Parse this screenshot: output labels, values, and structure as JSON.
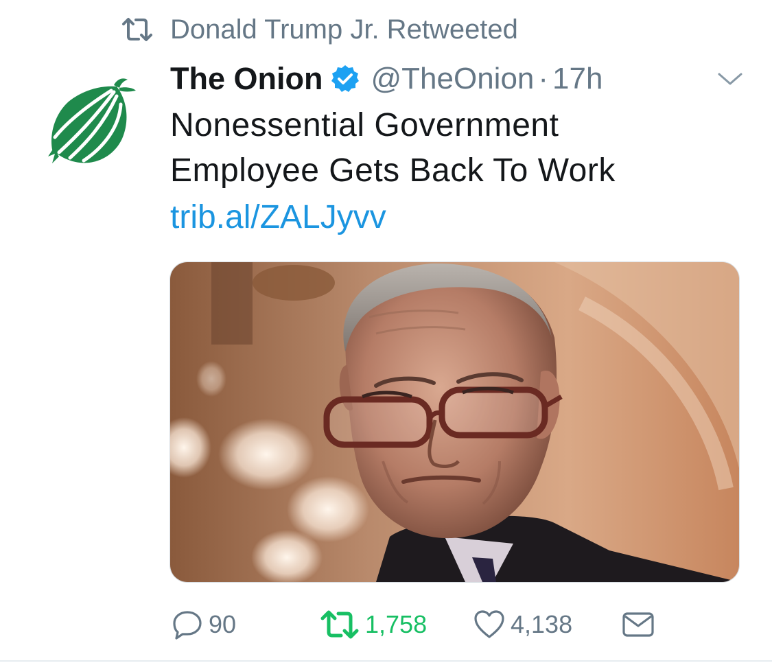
{
  "retweet_context": {
    "icon": "retweet-icon",
    "text": "Donald Trump Jr. Retweeted"
  },
  "author": {
    "display_name": "The Onion",
    "verified": true,
    "handle": "@TheOnion",
    "separator": "·",
    "time": "17h",
    "avatar_icon": "onion-logo",
    "brand_color": "#1f8a4c"
  },
  "tweet": {
    "text_line1": "Nonessential Government",
    "text_line2": "Employee Gets Back To Work",
    "link": "trib.al/ZALJyvv"
  },
  "media": {
    "type": "photo",
    "subject": "man-with-glasses-photo"
  },
  "actions": {
    "reply": {
      "icon": "reply-icon",
      "count": "90"
    },
    "retweet": {
      "icon": "retweet-icon",
      "count": "1,758",
      "active": true,
      "color": "#17bf63"
    },
    "like": {
      "icon": "heart-icon",
      "count": "4,138"
    },
    "dm": {
      "icon": "envelope-icon"
    }
  },
  "colors": {
    "text": "#14171a",
    "secondary": "#657786",
    "link": "#1b95e0",
    "verified": "#1da1f2"
  }
}
